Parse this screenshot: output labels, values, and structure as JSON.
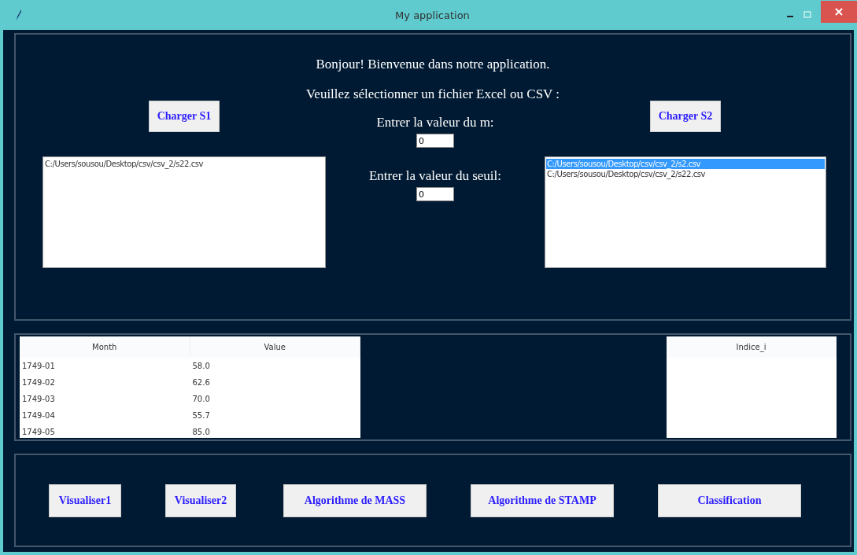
{
  "window": {
    "title": "My application"
  },
  "greeting": "Bonjour! Bienvenue dans notre application.",
  "instruction": "Veuillez sélectionner un fichier Excel ou CSV :",
  "left": {
    "button": "Charger S1",
    "files": [
      {
        "path": "C:/Users/sousou/Desktop/csv/csv_2/s22.csv",
        "selected": false
      }
    ]
  },
  "center": {
    "fields": [
      {
        "label": "Entrer la valeur du m:",
        "value": "0"
      },
      {
        "label": "Entrer la valeur du seuil:",
        "value": "0"
      }
    ]
  },
  "right": {
    "button": "Charger S2",
    "files": [
      {
        "path": "C:/Users/sousou/Desktop/csv/csv_2/s2.csv",
        "selected": true
      },
      {
        "path": "C:/Users/sousou/Desktop/csv/csv_2/s22.csv",
        "selected": false
      }
    ]
  },
  "data_table": {
    "columns": [
      "Month",
      "Value"
    ],
    "rows": [
      [
        "1749-01",
        "58.0"
      ],
      [
        "1749-02",
        "62.6"
      ],
      [
        "1749-03",
        "70.0"
      ],
      [
        "1749-04",
        "55.7"
      ],
      [
        "1749-05",
        "85.0"
      ]
    ]
  },
  "index_table": {
    "columns": [
      "Indice_i"
    ]
  },
  "actions": [
    "Visualiser1",
    "Visualiser2",
    "Algorithme de MASS",
    "Algorithme de STAMP",
    "Classification"
  ]
}
